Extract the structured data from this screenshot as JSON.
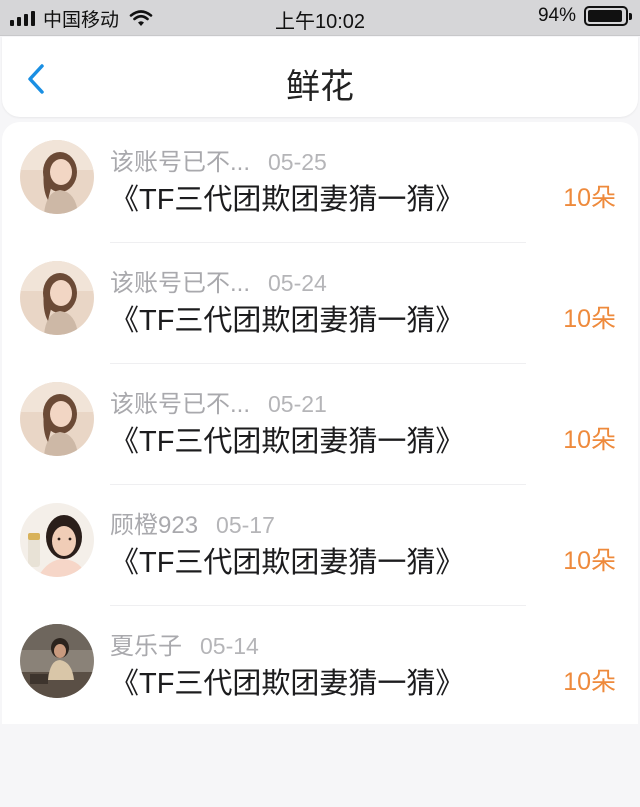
{
  "status_bar": {
    "carrier": "中国移动",
    "time": "上午10:02",
    "battery": "94%",
    "battery_level": 0.94
  },
  "nav": {
    "title": "鲜花",
    "back_icon": "chevron-left-icon"
  },
  "colors": {
    "accent": "#1a8fe3",
    "amount": "#ee8a3c"
  },
  "gifts": [
    {
      "nickname": "该账号已不...",
      "date": "05-25",
      "work": "《TF三代团欺团妻猜一猜》",
      "amount": "10朵"
    },
    {
      "nickname": "该账号已不...",
      "date": "05-24",
      "work": "《TF三代团欺团妻猜一猜》",
      "amount": "10朵"
    },
    {
      "nickname": "该账号已不...",
      "date": "05-21",
      "work": "《TF三代团欺团妻猜一猜》",
      "amount": "10朵"
    },
    {
      "nickname": "顾橙923",
      "date": "05-17",
      "work": "《TF三代团欺团妻猜一猜》",
      "amount": "10朵"
    },
    {
      "nickname": "夏乐子",
      "date": "05-14",
      "work": "《TF三代团欺团妻猜一猜》",
      "amount": "10朵"
    }
  ]
}
